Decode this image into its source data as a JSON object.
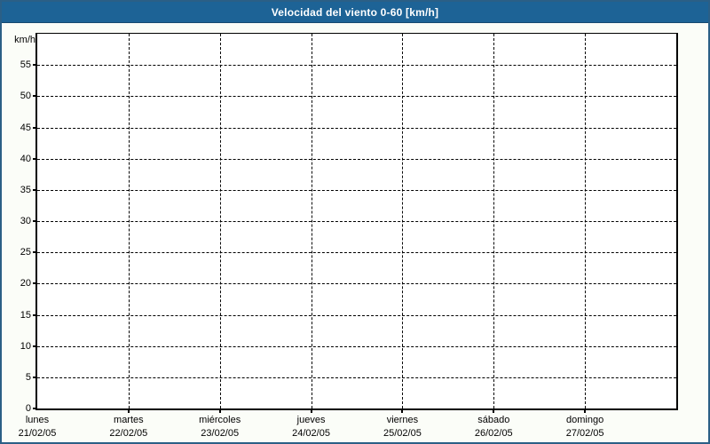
{
  "window": {
    "title": "Velocidad del viento 0-60 [km/h]"
  },
  "colors": {
    "titlebar_bg": "#1d6396",
    "titlebar_text": "#ffffff",
    "page_border": "#2b5f86",
    "page_bg": "#fbfdf8",
    "plot_bg": "#ffffff",
    "grid_and_axis": "#000000"
  },
  "chart_data": {
    "type": "line",
    "title": "Velocidad del viento 0-60 [km/h]",
    "ylabel": "km/h",
    "xlabel": "",
    "ylim": [
      0,
      60
    ],
    "y_ticks": [
      0,
      5,
      10,
      15,
      20,
      25,
      30,
      35,
      40,
      45,
      50,
      55
    ],
    "x_range_days": 7,
    "x_days": [
      {
        "day": "lunes",
        "date": "21/02/05"
      },
      {
        "day": "martes",
        "date": "22/02/05"
      },
      {
        "day": "miércoles",
        "date": "23/02/05"
      },
      {
        "day": "jueves",
        "date": "24/02/05"
      },
      {
        "day": "viernes",
        "date": "25/02/05"
      },
      {
        "day": "sábado",
        "date": "26/02/05"
      },
      {
        "day": "domingo",
        "date": "27/02/05"
      }
    ],
    "grid": "dashed, horizontal at every y tick and vertical at every day boundary",
    "legend": "none",
    "series": []
  }
}
